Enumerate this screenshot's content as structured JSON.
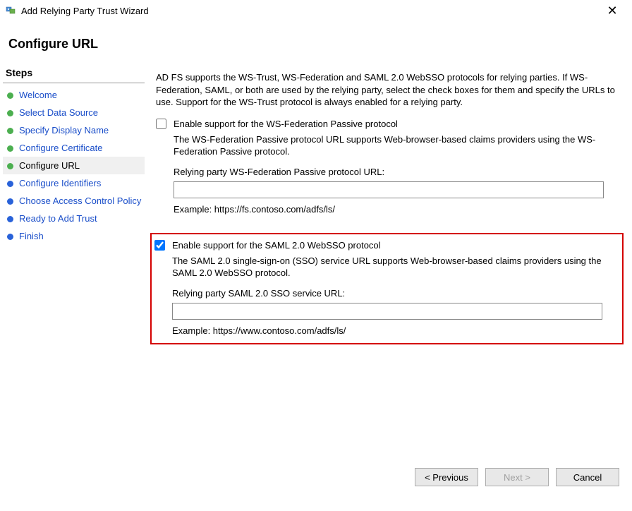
{
  "titlebar": {
    "title": "Add Relying Party Trust Wizard"
  },
  "page_heading": "Configure URL",
  "sidebar": {
    "header": "Steps",
    "items": [
      {
        "label": "Welcome",
        "state": "done"
      },
      {
        "label": "Select Data Source",
        "state": "done"
      },
      {
        "label": "Specify Display Name",
        "state": "done"
      },
      {
        "label": "Configure Certificate",
        "state": "done"
      },
      {
        "label": "Configure URL",
        "state": "current"
      },
      {
        "label": "Configure Identifiers",
        "state": "future"
      },
      {
        "label": "Choose Access Control Policy",
        "state": "future"
      },
      {
        "label": "Ready to Add Trust",
        "state": "future"
      },
      {
        "label": "Finish",
        "state": "future"
      }
    ]
  },
  "content": {
    "intro": "AD FS supports the WS-Trust, WS-Federation and SAML 2.0 WebSSO protocols for relying parties.  If WS-Federation, SAML, or both are used by the relying party, select the check boxes for them and specify the URLs to use.  Support for the WS-Trust protocol is always enabled for a relying party.",
    "wsfed": {
      "checkbox_label": "Enable support for the WS-Federation Passive protocol",
      "checked": false,
      "desc": "The WS-Federation Passive protocol URL supports Web-browser-based claims providers using the WS-Federation Passive protocol.",
      "url_label": "Relying party WS-Federation Passive protocol URL:",
      "url_value": "",
      "example": "Example: https://fs.contoso.com/adfs/ls/"
    },
    "saml": {
      "checkbox_label": "Enable support for the SAML 2.0 WebSSO protocol",
      "checked": true,
      "desc": "The SAML 2.0 single-sign-on (SSO) service URL supports Web-browser-based claims providers using the SAML 2.0 WebSSO protocol.",
      "url_label": "Relying party SAML 2.0 SSO service URL:",
      "url_value": "",
      "example": "Example: https://www.contoso.com/adfs/ls/"
    }
  },
  "buttons": {
    "previous": "< Previous",
    "next": "Next >",
    "cancel": "Cancel"
  }
}
